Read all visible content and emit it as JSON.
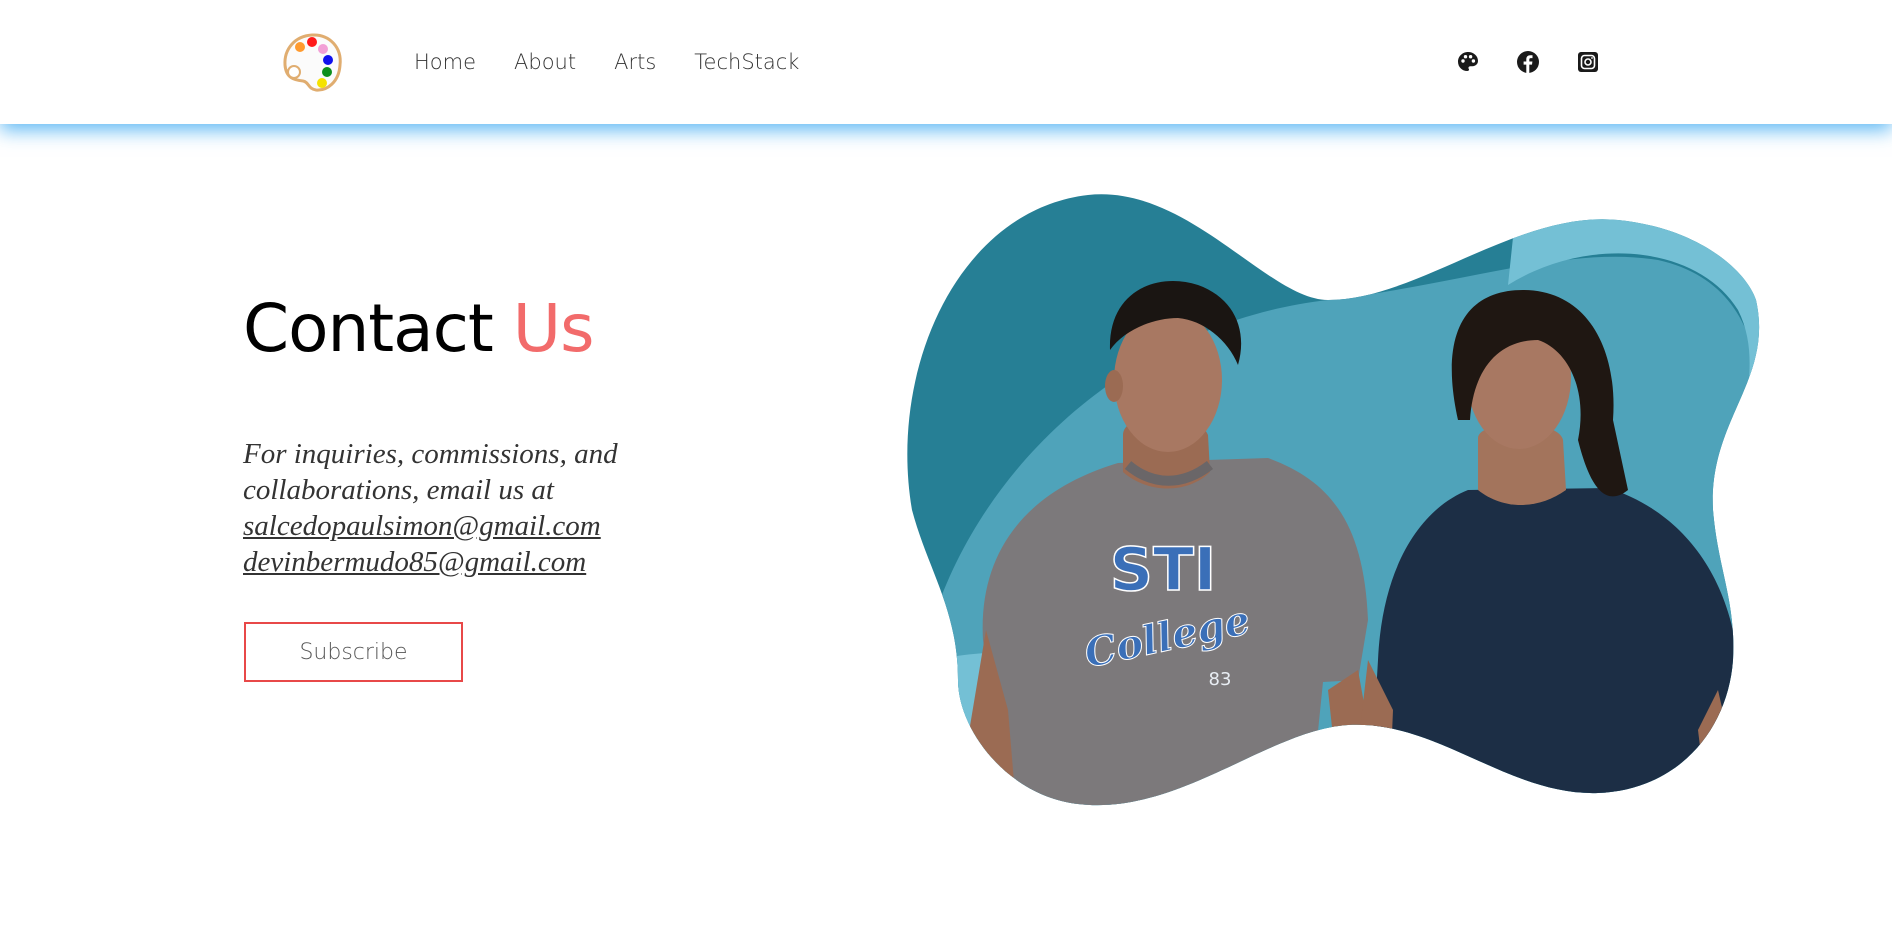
{
  "nav": {
    "links": [
      "Home",
      "About",
      "Arts",
      "TechStack"
    ],
    "social_icons": [
      "palette-icon",
      "facebook-icon",
      "instagram-icon"
    ]
  },
  "contact": {
    "title_main": "Contact",
    "title_accent": "Us",
    "intro_text": "For inquiries, commissions, and collaborations, email us at",
    "emails": [
      "salcedopaulsimon@gmail.com",
      "devinbermudo85@gmail.com"
    ],
    "subscribe_label": "Subscribe"
  },
  "hero": {
    "shirt_left_line1": "STI",
    "shirt_left_line2": "College",
    "shirt_left_number": "83"
  },
  "colors": {
    "accent": "#f26b6b",
    "button_border": "#e84848",
    "nav_shadow": "#28a0f0",
    "blob_dark": "#267f95",
    "blob_mid": "#4fa3ba",
    "blob_light": "#74c0d5"
  }
}
